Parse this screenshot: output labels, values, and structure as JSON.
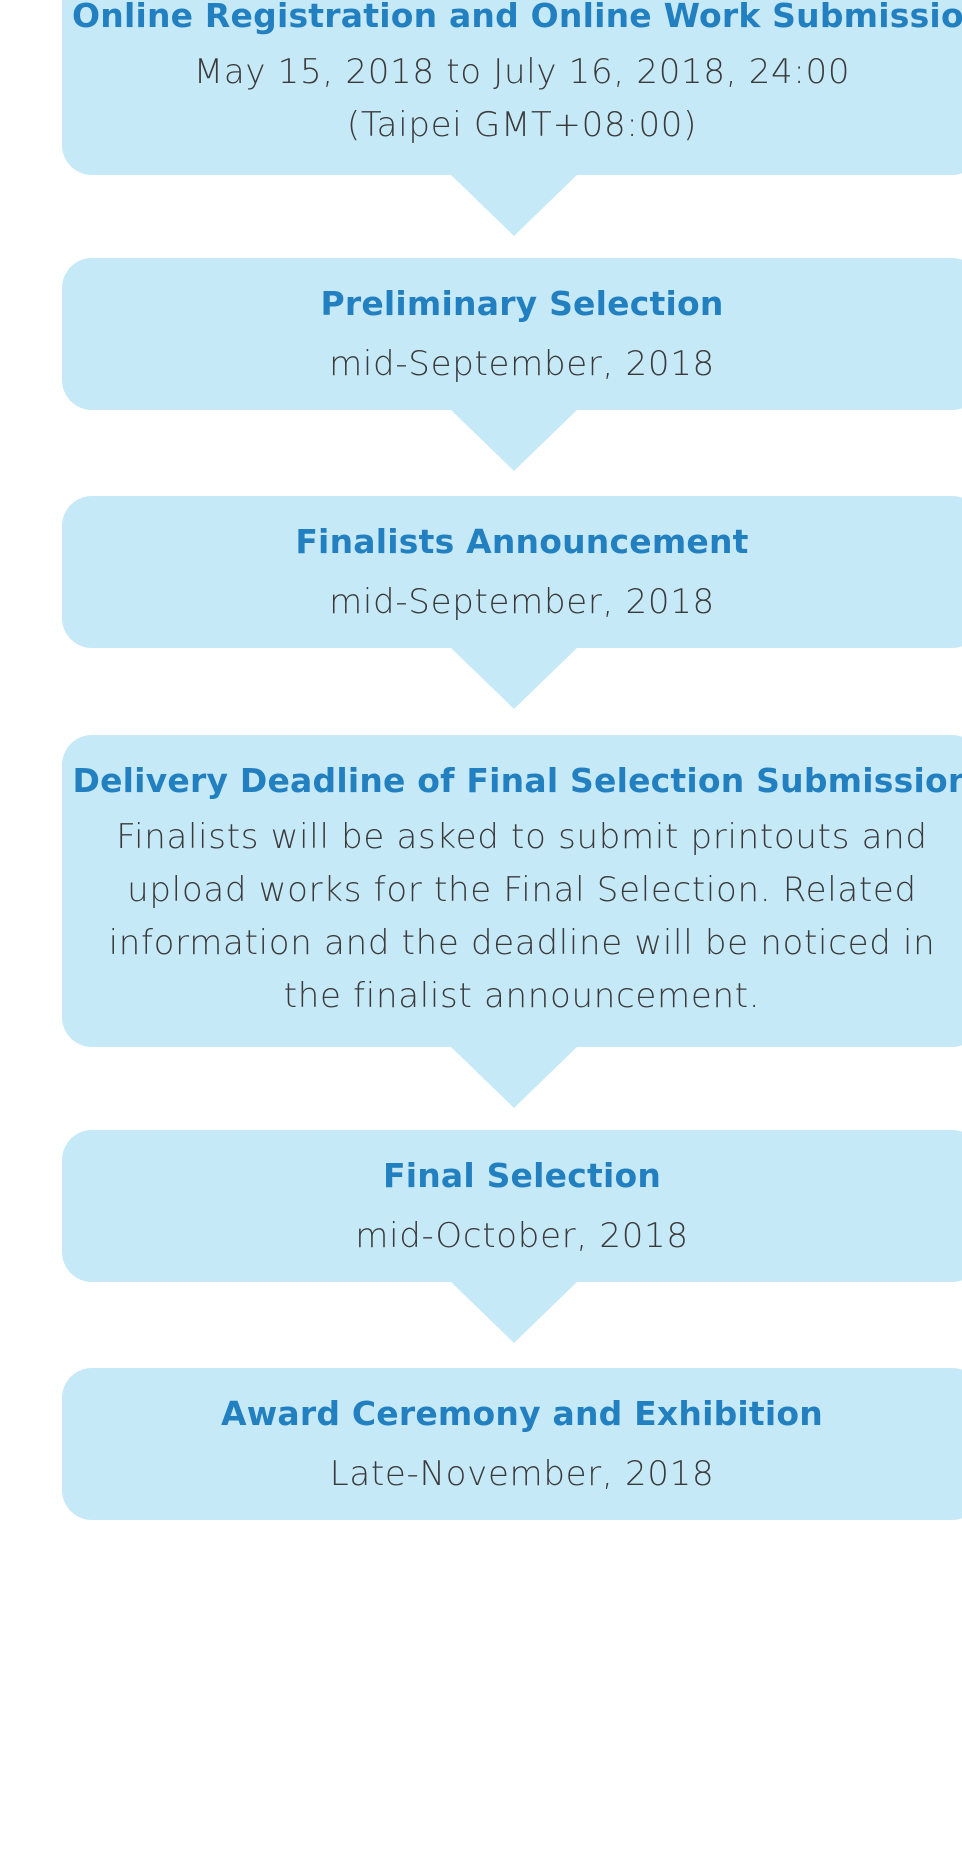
{
  "steps": [
    {
      "title": "Online Registration and Online Work Submission",
      "detail": "May 15, 2018 to July 16, 2018, 24:00 (Taipei GMT+08:00)"
    },
    {
      "title": "Preliminary Selection",
      "detail": "mid-September, 2018"
    },
    {
      "title": "Finalists Announcement",
      "detail": "mid-September, 2018"
    },
    {
      "title": "Delivery Deadline of Final Selection Submission",
      "detail": "Finalists will be asked to submit printouts and upload works for the Final Selection. Related information and the deadline will be noticed in the finalist announcement."
    },
    {
      "title": "Final Selection",
      "detail": "mid-October, 2018"
    },
    {
      "title": "Award Ceremony and Exhibition",
      "detail": "Late-November, 2018"
    }
  ],
  "colors": {
    "box_fill": "#c6e9f8",
    "title_text": "#2380c0",
    "detail_text": "#3a3a3a"
  }
}
